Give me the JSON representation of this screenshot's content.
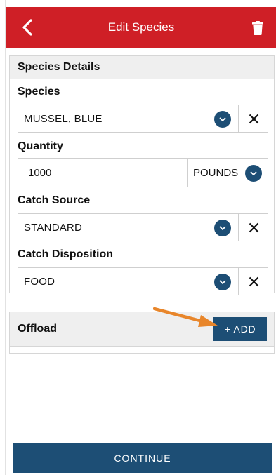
{
  "colors": {
    "brand": "#cf1f26",
    "accent": "#1d4e75",
    "annotation_arrow": "#e8862b"
  },
  "header": {
    "title": "Edit Species",
    "back_icon": "chevron-left-icon",
    "delete_icon": "trash-icon"
  },
  "species_details": {
    "title": "Species Details",
    "species": {
      "label": "Species",
      "value": "MUSSEL, BLUE"
    },
    "quantity": {
      "label": "Quantity",
      "value": "1000",
      "unit": "POUNDS"
    },
    "catch_source": {
      "label": "Catch Source",
      "value": "STANDARD"
    },
    "catch_disposition": {
      "label": "Catch Disposition",
      "value": "FOOD"
    }
  },
  "offload": {
    "title": "Offload",
    "add_label": "+ ADD"
  },
  "footer": {
    "continue_label": "CONTINUE"
  }
}
